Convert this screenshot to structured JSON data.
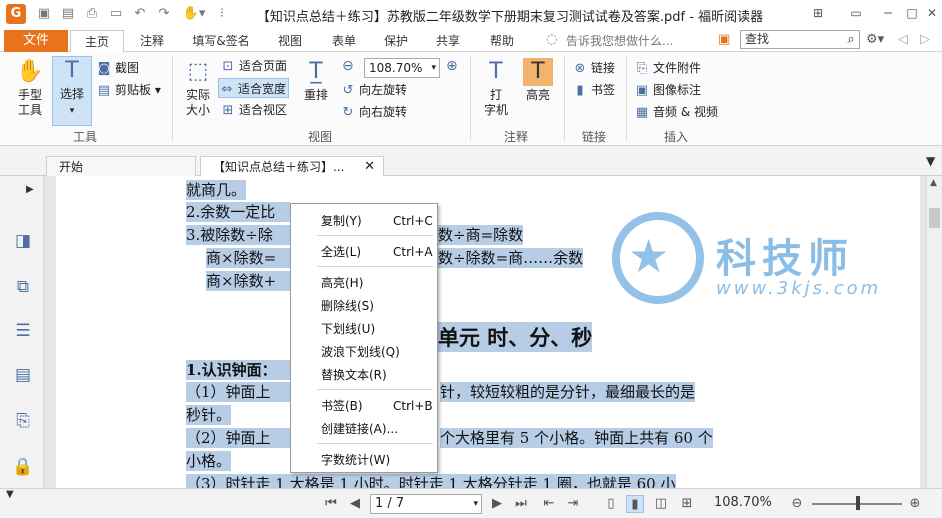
{
  "app": {
    "title": "【知识点总结＋练习】苏教版二年级数学下册期末复习测试试卷及答案.pdf - 福昕阅读器",
    "icon_letter": "G"
  },
  "quick_access": [
    "folder-icon",
    "save-icon",
    "print-icon",
    "window-icon",
    "undo-icon",
    "redo-icon",
    "hand-icon"
  ],
  "window_controls": [
    "ribbon-toggle-icon",
    "restore-icon",
    "minimize-icon",
    "maximize-icon",
    "close-icon"
  ],
  "menu": {
    "file": "文件",
    "tabs": [
      "主页",
      "注释",
      "填写&签名",
      "视图",
      "表单",
      "保护",
      "共享",
      "帮助"
    ],
    "tell_me": "告诉我您想做什么...",
    "search_placeholder": "查找"
  },
  "ribbon": {
    "tools": {
      "hand": "手型\n工具",
      "select": "选择",
      "screenshot": "截图",
      "clipboard": "剪贴板",
      "group": "工具"
    },
    "view": {
      "actual": "实际\n大小",
      "fit_page": "适合页面",
      "fit_width": "适合宽度",
      "fit_visible": "适合视区",
      "reflow": "重排",
      "zoom": "108.70%",
      "rotate_left": "向左旋转",
      "rotate_right": "向右旋转",
      "group": "视图"
    },
    "comment": {
      "typewriter": "打\n字机",
      "highlight": "高亮",
      "group": "注释"
    },
    "links": {
      "link": "链接",
      "bookmark": "书签",
      "group": "链接"
    },
    "insert": {
      "file_attach": "文件附件",
      "image_annot": "图像标注",
      "audio_video": "音频 & 视频",
      "group": "插入"
    }
  },
  "doc_tabs": {
    "start": "开始",
    "current": "【知识点总结＋练习】..."
  },
  "document": {
    "lines": [
      "就商几。",
      "2.余数一定比除数小。",
      "3.被除数÷除数=商……余数　　被除数÷商=除数",
      "商×除数=被除数　　（被除数-余数）÷除数=商……余数",
      "商×除数+余数=被除数",
      "第六单元  时、分、秒",
      "1.认识钟面：",
      "（1）钟面上有时针和分针，较短较粗的是分针，最细最长的是",
      "秒针。",
      "（2）钟面上有 12 个大格，每个大格里有 5 个小格。钟面上共有 60 个",
      "小格。",
      "（3）时针走 1 大格是 1 小时。时针走 1 大格分针走 1 圈，也就是 60 小"
    ],
    "visible": {
      "l1": "就商几。",
      "l2a": "2.余数一定比",
      "l2b": "",
      "l3a": "3.被除数÷除",
      "l3b": "数÷商=除数",
      "l4a": "商×除数=",
      "l4b": "数÷除数=商……余数",
      "l5a": "商×除数+",
      "heading": "单元 时、分、秒",
      "l6": "1.认识钟面：",
      "l7a": "（1）钟面上",
      "l7b": "针，较短较粗的是分针，最细最长的是",
      "l8": "秒针。",
      "l9a": "（2）钟面上",
      "l9b": "个大格里有 5 个小格。钟面上共有 60 个",
      "l10": "小格。",
      "l11": "（3）时针走 1 大格是 1 小时。时针走 1 大格分针走 1 圈，也就是 60 小"
    },
    "watermark": {
      "text": "科技师",
      "url": "www.3kjs.com"
    }
  },
  "context_menu": [
    {
      "label": "复制(Y)",
      "shortcut": "Ctrl+C"
    },
    {
      "label": "全选(L)",
      "shortcut": "Ctrl+A"
    },
    {
      "label": "高亮(H)",
      "shortcut": ""
    },
    {
      "label": "删除线(S)",
      "shortcut": ""
    },
    {
      "label": "下划线(U)",
      "shortcut": ""
    },
    {
      "label": "波浪下划线(Q)",
      "shortcut": ""
    },
    {
      "label": "替换文本(R)",
      "shortcut": ""
    },
    {
      "label": "书签(B)",
      "shortcut": "Ctrl+B"
    },
    {
      "label": "创建链接(A)...",
      "shortcut": ""
    },
    {
      "label": "字数统计(W)",
      "shortcut": ""
    }
  ],
  "status": {
    "page": "1 / 7",
    "zoom": "108.70%"
  },
  "colors": {
    "accent": "#e8731c",
    "selection": "#b7cde6",
    "icon": "#4d6fa3",
    "watermark": "#6eaee2"
  }
}
